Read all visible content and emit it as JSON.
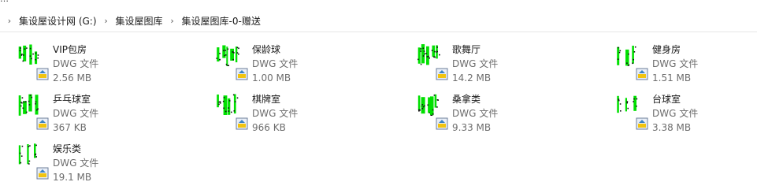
{
  "top_fragment": "…",
  "breadcrumb": [
    "集设屋设计网 (G:)",
    "集设屋图库",
    "集设屋图库-0-赠送"
  ],
  "files": [
    {
      "name": "VIP包房",
      "type": "DWG 文件",
      "size": "2.56 MB",
      "thumb_icon": "cad-drawing-thumbnail-icon",
      "badge_icon": "dwg-file-badge-icon"
    },
    {
      "name": "保龄球",
      "type": "DWG 文件",
      "size": "1.00 MB",
      "thumb_icon": "cad-drawing-thumbnail-icon",
      "badge_icon": "dwg-file-badge-icon"
    },
    {
      "name": "歌舞厅",
      "type": "DWG 文件",
      "size": "14.2 MB",
      "thumb_icon": "cad-drawing-thumbnail-icon",
      "badge_icon": "dwg-file-badge-icon"
    },
    {
      "name": "健身房",
      "type": "DWG 文件",
      "size": "1.51 MB",
      "thumb_icon": "cad-drawing-thumbnail-icon",
      "badge_icon": "dwg-file-badge-icon"
    },
    {
      "name": "乒乓球室",
      "type": "DWG 文件",
      "size": "367 KB",
      "thumb_icon": "cad-drawing-thumbnail-icon",
      "badge_icon": "dwg-file-badge-icon"
    },
    {
      "name": "棋牌室",
      "type": "DWG 文件",
      "size": "966 KB",
      "thumb_icon": "cad-drawing-thumbnail-icon",
      "badge_icon": "dwg-file-badge-icon"
    },
    {
      "name": "桑拿类",
      "type": "DWG 文件",
      "size": "9.33 MB",
      "thumb_icon": "cad-drawing-thumbnail-icon",
      "badge_icon": "dwg-file-badge-icon"
    },
    {
      "name": "台球室",
      "type": "DWG 文件",
      "size": "3.38 MB",
      "thumb_icon": "cad-drawing-thumbnail-icon",
      "badge_icon": "dwg-file-badge-icon"
    },
    {
      "name": "娱乐类",
      "type": "DWG 文件",
      "size": "19.1 MB",
      "thumb_icon": "cad-drawing-thumbnail-icon",
      "badge_icon": "dwg-file-badge-icon"
    }
  ],
  "colors": {
    "drawing_green": "#00e000",
    "drawing_black": "#111111",
    "badge_paper": "#e8eef8",
    "badge_yellow": "#f2c40f"
  }
}
